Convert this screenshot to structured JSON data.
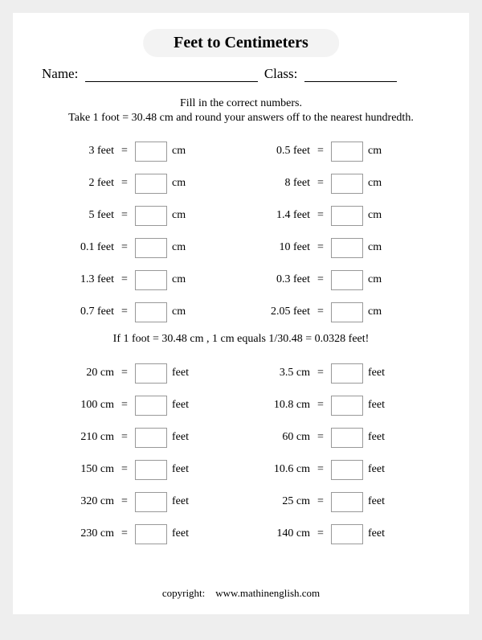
{
  "title": "Feet to Centimeters",
  "name_label": "Name:",
  "class_label": "Class:",
  "instruction_line1": "Fill in the correct numbers.",
  "instruction_line2": "Take 1 foot = 30.48 cm and round your answers off to the nearest hundredth.",
  "mid_note": "If 1 foot = 30.48 cm , 1 cm equals 1/30.48 = 0.0328 feet!",
  "section1_from_unit": "feet",
  "section1_to_unit": "cm",
  "section2_from_unit": "cm",
  "section2_to_unit": "feet",
  "section1": [
    {
      "left": "3",
      "right": "0.5"
    },
    {
      "left": "2",
      "right": "8"
    },
    {
      "left": "5",
      "right": "1.4"
    },
    {
      "left": "0.1",
      "right": "10"
    },
    {
      "left": "1.3",
      "right": "0.3"
    },
    {
      "left": "0.7",
      "right": "2.05"
    }
  ],
  "section2": [
    {
      "left": "20",
      "right": "3.5"
    },
    {
      "left": "100",
      "right": "10.8"
    },
    {
      "left": "210",
      "right": "60"
    },
    {
      "left": "150",
      "right": "10.6"
    },
    {
      "left": "320",
      "right": "25"
    },
    {
      "left": "230",
      "right": "140"
    }
  ],
  "copyright_label": "copyright:",
  "copyright_url": "www.mathinenglish.com"
}
